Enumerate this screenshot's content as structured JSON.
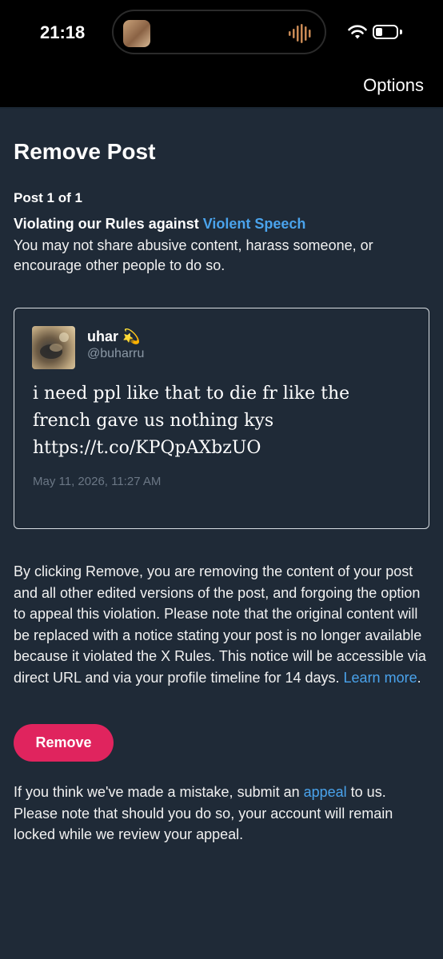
{
  "status_bar": {
    "time": "21:18",
    "battery_level": 0.35
  },
  "header": {
    "options_label": "Options"
  },
  "page": {
    "title": "Remove Post",
    "post_count": "Post 1 of 1",
    "violation_prefix": "Violating our Rules against ",
    "violation_link": "Violent Speech",
    "violation_desc": "You may not share abusive content, harass someone, or encourage other people to do so."
  },
  "post": {
    "author_name": "uhar",
    "author_emoji": "💫",
    "author_handle": "@buharru",
    "text": "i need ppl like that to die fr like the french gave us nothing kys https://t.co/KPQpAXbzUO",
    "date": "May 11, 2026, 11:27 AM"
  },
  "info": {
    "text": "By clicking Remove, you are removing the content of your post and all other edited versions of the post, and forgoing the option to appeal this violation. Please note that the original content will be replaced with a notice stating your post is no longer available because it violated the X Rules. This notice will be accessible via direct URL and via your profile timeline for 14 days. ",
    "learn_more": "Learn more",
    "period": "."
  },
  "actions": {
    "remove_label": "Remove"
  },
  "appeal": {
    "prefix": "If you think we've made a mistake, submit an ",
    "link": "appeal",
    "suffix": " to us. Please note that should you do so, your account will remain locked while we review your appeal."
  },
  "colors": {
    "background": "#1f2a37",
    "link": "#4aa3ec",
    "remove_button": "#e0245e"
  }
}
